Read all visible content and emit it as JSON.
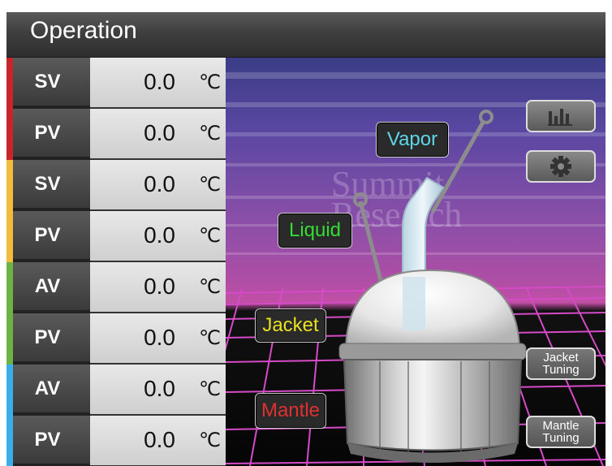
{
  "title": "Operation",
  "rows": [
    {
      "tag": "SV",
      "value": "0.0",
      "unit": "℃",
      "color": "#c8252b"
    },
    {
      "tag": "PV",
      "value": "0.0",
      "unit": "℃",
      "color": "#c8252b"
    },
    {
      "tag": "SV",
      "value": "0.0",
      "unit": "℃",
      "color": "#f2bb3a"
    },
    {
      "tag": "PV",
      "value": "0.0",
      "unit": "℃",
      "color": "#f2bb3a"
    },
    {
      "tag": "AV",
      "value": "0.0",
      "unit": "℃",
      "color": "#6cb245"
    },
    {
      "tag": "PV",
      "value": "0.0",
      "unit": "℃",
      "color": "#6cb245"
    },
    {
      "tag": "AV",
      "value": "0.0",
      "unit": "℃",
      "color": "#3aaee8"
    },
    {
      "tag": "PV",
      "value": "0.0",
      "unit": "℃",
      "color": "#3aaee8"
    }
  ],
  "scene": {
    "watermark_line1": "Summit",
    "watermark_line2": "Research",
    "labels": {
      "vapor": "Vapor",
      "liquid": "Liquid",
      "jacket": "Jacket",
      "mantle": "Mantle"
    },
    "colors": {
      "vapor": "#5ed6e8",
      "liquid": "#33dd33",
      "jacket": "#e8e020",
      "mantle": "#e03030"
    },
    "buttons": {
      "chart_icon": "bar-chart-icon",
      "settings_icon": "gear-icon",
      "jacket_tuning_line1": "Jacket",
      "jacket_tuning_line2": "Tuning",
      "mantle_tuning_line1": "Mantle",
      "mantle_tuning_line2": "Tuning"
    }
  }
}
